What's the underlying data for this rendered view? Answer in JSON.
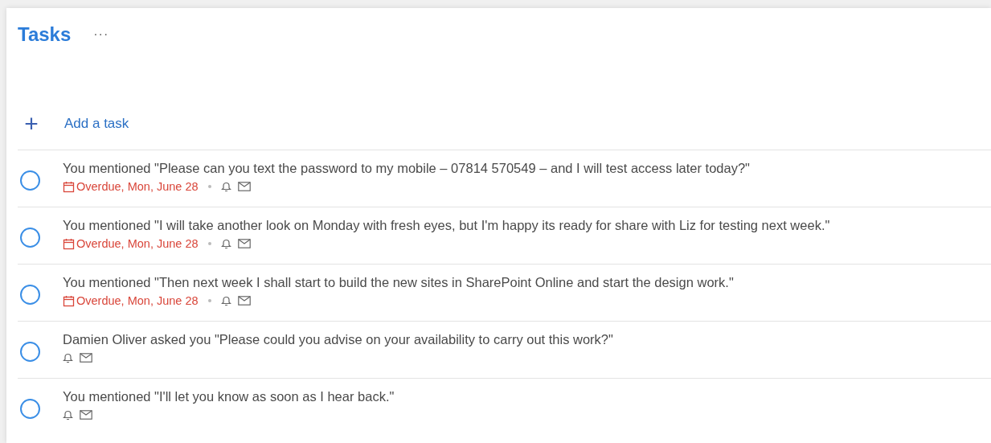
{
  "header": {
    "title": "Tasks",
    "more": "···"
  },
  "add_task": {
    "icon": "+",
    "label": "Add a task"
  },
  "tasks": [
    {
      "text": "You mentioned \"Please can you text the password to my mobile – 07814 570549 – and I will test access later today?\"",
      "checked": false,
      "due": "Overdue, Mon, June 28",
      "overdue": true
    },
    {
      "text": "You mentioned \"I will take another look on Monday with fresh eyes, but I'm happy its ready for share with Liz for testing next week.\"",
      "checked": false,
      "due": "Overdue, Mon, June 28",
      "overdue": true
    },
    {
      "text": "You mentioned \"Then next week I shall start to build the new sites in SharePoint Online and start the design work.\"",
      "checked": false,
      "due": "Overdue, Mon, June 28",
      "overdue": true
    },
    {
      "text": "Damien Oliver asked you \"Please could you advise on your availability to carry out this work?\"",
      "checked": false
    },
    {
      "text": "You mentioned \"I'll let you know as soon as I hear back.\"",
      "checked": false
    }
  ]
}
